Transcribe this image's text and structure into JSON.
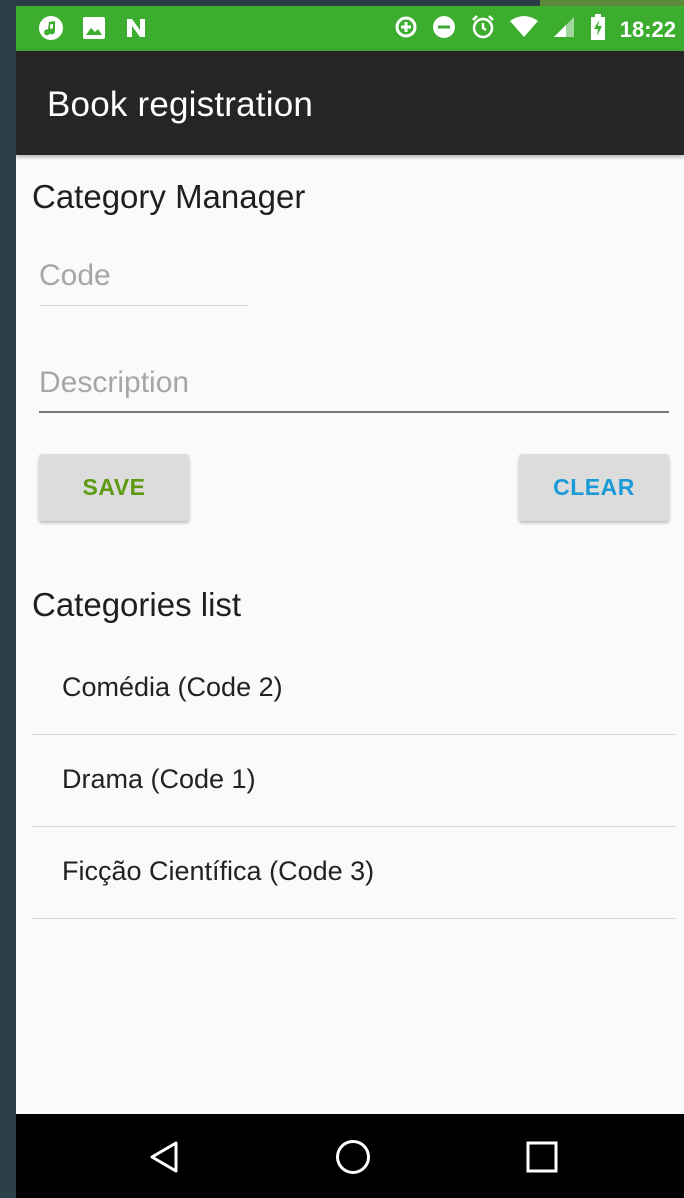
{
  "status_bar": {
    "time": "18:22",
    "left_icons": [
      "music-note-icon",
      "image-icon",
      "n-notification-icon"
    ],
    "right_icons": [
      "data-saver-icon",
      "do-not-disturb-icon",
      "alarm-icon",
      "wifi-icon",
      "cell-signal-icon",
      "battery-charging-icon"
    ],
    "color": "#3cad2f"
  },
  "app_bar": {
    "title": "Book registration",
    "color": "#252525"
  },
  "category_manager": {
    "title": "Category Manager",
    "code_field": {
      "value": "",
      "placeholder": "Code"
    },
    "description_field": {
      "value": "",
      "placeholder": "Description"
    },
    "save_label": "SAVE",
    "save_color": "#5e9a12",
    "clear_label": "CLEAR",
    "clear_color": "#1a9bd7"
  },
  "categories_list": {
    "title": "Categories list",
    "items": [
      {
        "label": "Comédia (Code 2)"
      },
      {
        "label": "Drama (Code 1)"
      },
      {
        "label": "Ficção Científica (Code 3)"
      }
    ]
  },
  "nav_bar": {
    "icons": [
      "back-icon",
      "home-icon",
      "recents-icon"
    ]
  }
}
